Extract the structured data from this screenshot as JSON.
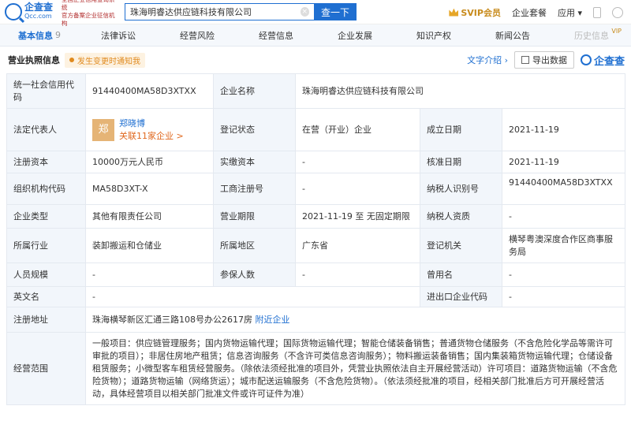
{
  "header": {
    "logo_cn": "企查查",
    "logo_en": "Qcc.com",
    "logo_desc_1": "全国企业信用查询系统",
    "logo_desc_2": "官方备案企业征信机构",
    "search_value": "珠海明睿达供应链科技有限公司",
    "search_button": "查一下",
    "svip": "SVIP会员",
    "suite": "企业套餐",
    "apps": "应用"
  },
  "nav": {
    "items": [
      {
        "label": "基本信息",
        "count": "9"
      },
      {
        "label": "法律诉讼"
      },
      {
        "label": "经营风险"
      },
      {
        "label": "经营信息"
      },
      {
        "label": "企业发展"
      },
      {
        "label": "知识产权"
      },
      {
        "label": "新闻公告"
      },
      {
        "label": "历史信息",
        "vip": "VIP"
      }
    ]
  },
  "section": {
    "title": "营业执照信息",
    "badge": "发生变更时通知我",
    "intro": "文字介绍",
    "export": "导出数据",
    "brand": "企查查"
  },
  "rows": {
    "credit_code_k": "统一社会信用代码",
    "credit_code_v": "91440400MA58D3XTXX",
    "company_name_k": "企业名称",
    "company_name_v": "珠海明睿达供应链科技有限公司",
    "legal_rep_k": "法定代表人",
    "legal_avatar": "郑",
    "legal_name": "郑晓博",
    "legal_rel": "关联11家企业 >",
    "reg_status_k": "登记状态",
    "reg_status_v": "在营（开业）企业",
    "est_date_k": "成立日期",
    "est_date_v": "2021-11-19",
    "reg_capital_k": "注册资本",
    "reg_capital_v": "10000万元人民币",
    "paid_capital_k": "实缴资本",
    "paid_capital_v": "-",
    "approve_date_k": "核准日期",
    "approve_date_v": "2021-11-19",
    "org_code_k": "组织机构代码",
    "org_code_v": "MA58D3XT-X",
    "biz_reg_no_k": "工商注册号",
    "biz_reg_no_v": "-",
    "taxpayer_id_k": "纳税人识别号",
    "taxpayer_id_v": "91440400MA58D3XTXX",
    "company_type_k": "企业类型",
    "company_type_v": "其他有限责任公司",
    "biz_term_k": "营业期限",
    "biz_term_v": "2021-11-19 至 无固定期限",
    "taxpayer_qual_k": "纳税人资质",
    "taxpayer_qual_v": "-",
    "industry_k": "所属行业",
    "industry_v": "装卸搬运和仓储业",
    "region_k": "所属地区",
    "region_v": "广东省",
    "reg_authority_k": "登记机关",
    "reg_authority_v": "横琴粤澳深度合作区商事服务局",
    "staff_size_k": "人员规模",
    "staff_size_v": "-",
    "insured_k": "参保人数",
    "insured_v": "-",
    "former_name_k": "曾用名",
    "former_name_v": "-",
    "en_name_k": "英文名",
    "en_name_v": "-",
    "ie_code_k": "进出口企业代码",
    "ie_code_v": "-",
    "address_k": "注册地址",
    "address_v": "珠海横琴新区汇通三路108号办公2617房",
    "nearby": "附近企业",
    "scope_k": "经营范围",
    "scope_v": "一般项目：供应链管理服务；国内货物运输代理；国际货物运输代理；智能仓储装备销售；普通货物仓储服务（不含危险化学品等需许可审批的项目）；非居住房地产租赁；信息咨询服务（不含许可类信息咨询服务）；物料搬运装备销售；国内集装箱货物运输代理；仓储设备租赁服务；小微型客车租赁经营服务。（除依法须经批准的项目外，凭营业执照依法自主开展经营活动）许可项目：道路货物运输（不含危险货物）；道路货物运输（网络货运）；城市配送运输服务（不含危险货物）。（依法须经批准的项目，经相关部门批准后方可开展经营活动，具体经营项目以相关部门批准文件或许可证件为准）"
  }
}
